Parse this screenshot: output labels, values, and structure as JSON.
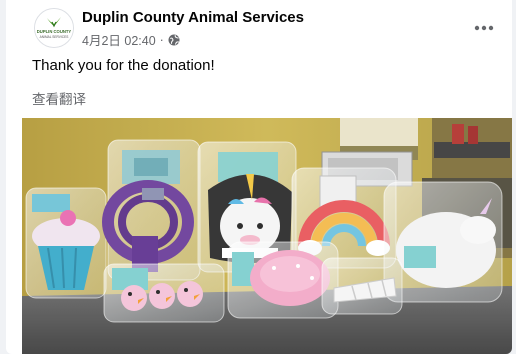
{
  "post": {
    "page_name": "Duplin County Animal Services",
    "timestamp": "4月2日 02:40",
    "separator": "·",
    "audience_icon": "globe-icon",
    "text": "Thank you for the donation!",
    "translate_link": "查看翻译",
    "more_icon": "more-horizontal-icon"
  },
  "avatar": {
    "logo_text": "DUPLIN COUNTY",
    "logo_sub": "ANIMAL SERVICES",
    "accent": "#5aa02c"
  },
  "photo": {
    "subject": "donated pet toys in plastic bags on a table",
    "colors": {
      "wall": "#c9b24a",
      "table": "#5a5a5a",
      "cupcake": "#6fc3d6",
      "rope": "#6b3d9a",
      "unicorn": "#f2f2f2",
      "donut": "#f3a8c7",
      "rainbow": "#e8565a"
    }
  }
}
